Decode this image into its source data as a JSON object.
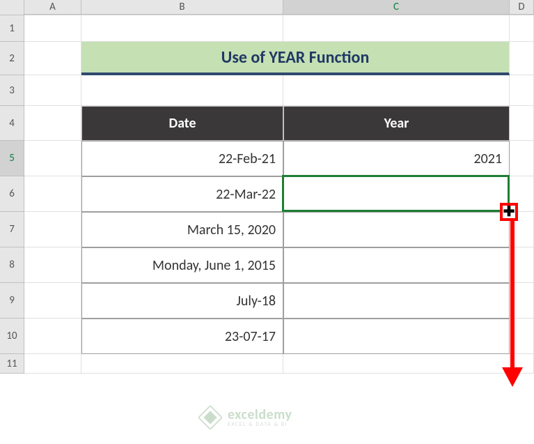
{
  "columns": {
    "A": "A",
    "B": "B",
    "C": "C",
    "D": "D"
  },
  "row_numbers": [
    "1",
    "2",
    "3",
    "4",
    "5",
    "6",
    "7",
    "8",
    "9",
    "10",
    "11"
  ],
  "title": "Use of YEAR Function",
  "table": {
    "headers": {
      "date": "Date",
      "year": "Year"
    },
    "rows": [
      {
        "date": "22-Feb-21",
        "year": "2021"
      },
      {
        "date": "22-Mar-22",
        "year": ""
      },
      {
        "date": "March 15, 2020",
        "year": ""
      },
      {
        "date": "Monday, June 1, 2015",
        "year": ""
      },
      {
        "date": "July-18",
        "year": ""
      },
      {
        "date": "23-07-17",
        "year": ""
      }
    ]
  },
  "selection": {
    "cell": "C5"
  },
  "watermark": {
    "brand": "exceldemy",
    "tag": "EXCEL & DATA & BI"
  },
  "chart_data": {
    "type": "table",
    "title": "Use of YEAR Function",
    "columns": [
      "Date",
      "Year"
    ],
    "rows": [
      [
        "22-Feb-21",
        2021
      ],
      [
        "22-Mar-22",
        null
      ],
      [
        "March 15, 2020",
        null
      ],
      [
        "Monday, June 1, 2015",
        null
      ],
      [
        "July-18",
        null
      ],
      [
        "23-07-17",
        null
      ]
    ]
  }
}
